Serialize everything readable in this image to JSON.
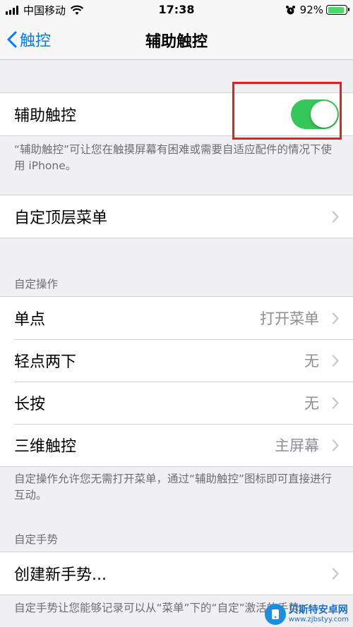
{
  "status_bar": {
    "carrier": "中国移动",
    "time": "17:38",
    "battery_percent": "92%",
    "battery_level": 0.92
  },
  "nav": {
    "back_label": "触控",
    "title": "辅助触控"
  },
  "assistive_touch": {
    "label": "辅助触控",
    "enabled": true,
    "footer": "“辅助触控”可让您在触摸屏幕有困难或需要自适应配件的情况下使用 iPhone。"
  },
  "customize_menu": {
    "label": "自定顶层菜单"
  },
  "custom_actions": {
    "header": "自定操作",
    "rows": [
      {
        "label": "单点",
        "value": "打开菜单"
      },
      {
        "label": "轻点两下",
        "value": "无"
      },
      {
        "label": "长按",
        "value": "无"
      },
      {
        "label": "三维触控",
        "value": "主屏幕"
      }
    ],
    "footer": "自定操作允许您无需打开菜单，通过“辅助触控”图标即可直接进行互动。"
  },
  "custom_gestures": {
    "header": "自定手势",
    "create_label": "创建新手势...",
    "footer": "自定手势让您能够记录可以从“菜单”下的“自定”激活的手势。"
  },
  "watermark": {
    "name": "贝斯特安卓网",
    "url": "www.zjbstyy.com"
  },
  "colors": {
    "accent": "#007aff",
    "toggle_on": "#34c759",
    "highlight_box": "#e51e1e"
  }
}
